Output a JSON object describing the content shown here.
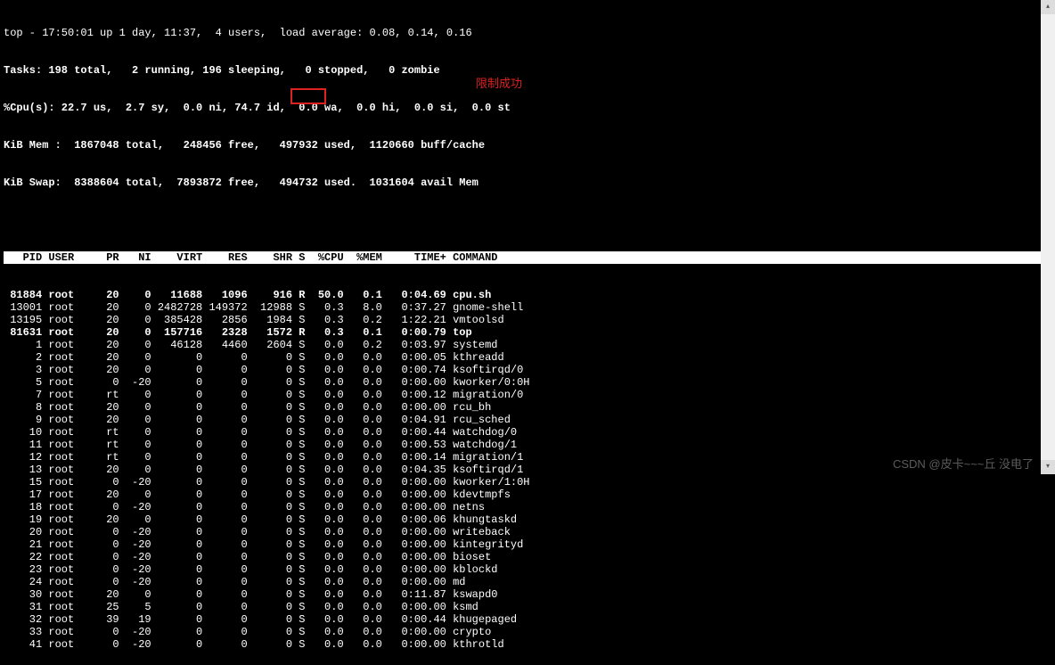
{
  "summary": {
    "line1": "top - 17:50:01 up 1 day, 11:37,  4 users,  load average: 0.08, 0.14, 0.16",
    "line2": "Tasks: 198 total,   2 running, 196 sleeping,   0 stopped,   0 zombie",
    "line3": "%Cpu(s): 22.7 us,  2.7 sy,  0.0 ni, 74.7 id,  0.0 wa,  0.0 hi,  0.0 si,  0.0 st",
    "line4": "KiB Mem :  1867048 total,   248456 free,   497932 used,  1120660 buff/cache",
    "line5": "KiB Swap:  8388604 total,  7893872 free,   494732 used.  1031604 avail Mem"
  },
  "columns": [
    "PID",
    "USER",
    "PR",
    "NI",
    "VIRT",
    "RES",
    "SHR",
    "S",
    "%CPU",
    "%MEM",
    "TIME+",
    "COMMAND"
  ],
  "annotation": "限制成功",
  "processes": [
    {
      "bold": true,
      "pid": "81884",
      "user": "root",
      "pr": "20",
      "ni": "0",
      "virt": "11688",
      "res": "1096",
      "shr": "916",
      "s": "R",
      "cpu": "50.0",
      "mem": "0.1",
      "time": "0:04.69",
      "cmd": "cpu.sh"
    },
    {
      "bold": false,
      "pid": "13001",
      "user": "root",
      "pr": "20",
      "ni": "0",
      "virt": "2482728",
      "res": "149372",
      "shr": "12988",
      "s": "S",
      "cpu": "0.3",
      "mem": "8.0",
      "time": "0:37.27",
      "cmd": "gnome-shell"
    },
    {
      "bold": false,
      "pid": "13195",
      "user": "root",
      "pr": "20",
      "ni": "0",
      "virt": "385428",
      "res": "2856",
      "shr": "1984",
      "s": "S",
      "cpu": "0.3",
      "mem": "0.2",
      "time": "1:22.21",
      "cmd": "vmtoolsd"
    },
    {
      "bold": true,
      "pid": "81631",
      "user": "root",
      "pr": "20",
      "ni": "0",
      "virt": "157716",
      "res": "2328",
      "shr": "1572",
      "s": "R",
      "cpu": "0.3",
      "mem": "0.1",
      "time": "0:00.79",
      "cmd": "top"
    },
    {
      "bold": false,
      "pid": "1",
      "user": "root",
      "pr": "20",
      "ni": "0",
      "virt": "46128",
      "res": "4460",
      "shr": "2604",
      "s": "S",
      "cpu": "0.0",
      "mem": "0.2",
      "time": "0:03.97",
      "cmd": "systemd"
    },
    {
      "bold": false,
      "pid": "2",
      "user": "root",
      "pr": "20",
      "ni": "0",
      "virt": "0",
      "res": "0",
      "shr": "0",
      "s": "S",
      "cpu": "0.0",
      "mem": "0.0",
      "time": "0:00.05",
      "cmd": "kthreadd"
    },
    {
      "bold": false,
      "pid": "3",
      "user": "root",
      "pr": "20",
      "ni": "0",
      "virt": "0",
      "res": "0",
      "shr": "0",
      "s": "S",
      "cpu": "0.0",
      "mem": "0.0",
      "time": "0:00.74",
      "cmd": "ksoftirqd/0"
    },
    {
      "bold": false,
      "pid": "5",
      "user": "root",
      "pr": "0",
      "ni": "-20",
      "virt": "0",
      "res": "0",
      "shr": "0",
      "s": "S",
      "cpu": "0.0",
      "mem": "0.0",
      "time": "0:00.00",
      "cmd": "kworker/0:0H"
    },
    {
      "bold": false,
      "pid": "7",
      "user": "root",
      "pr": "rt",
      "ni": "0",
      "virt": "0",
      "res": "0",
      "shr": "0",
      "s": "S",
      "cpu": "0.0",
      "mem": "0.0",
      "time": "0:00.12",
      "cmd": "migration/0"
    },
    {
      "bold": false,
      "pid": "8",
      "user": "root",
      "pr": "20",
      "ni": "0",
      "virt": "0",
      "res": "0",
      "shr": "0",
      "s": "S",
      "cpu": "0.0",
      "mem": "0.0",
      "time": "0:00.00",
      "cmd": "rcu_bh"
    },
    {
      "bold": false,
      "pid": "9",
      "user": "root",
      "pr": "20",
      "ni": "0",
      "virt": "0",
      "res": "0",
      "shr": "0",
      "s": "S",
      "cpu": "0.0",
      "mem": "0.0",
      "time": "0:04.91",
      "cmd": "rcu_sched"
    },
    {
      "bold": false,
      "pid": "10",
      "user": "root",
      "pr": "rt",
      "ni": "0",
      "virt": "0",
      "res": "0",
      "shr": "0",
      "s": "S",
      "cpu": "0.0",
      "mem": "0.0",
      "time": "0:00.44",
      "cmd": "watchdog/0"
    },
    {
      "bold": false,
      "pid": "11",
      "user": "root",
      "pr": "rt",
      "ni": "0",
      "virt": "0",
      "res": "0",
      "shr": "0",
      "s": "S",
      "cpu": "0.0",
      "mem": "0.0",
      "time": "0:00.53",
      "cmd": "watchdog/1"
    },
    {
      "bold": false,
      "pid": "12",
      "user": "root",
      "pr": "rt",
      "ni": "0",
      "virt": "0",
      "res": "0",
      "shr": "0",
      "s": "S",
      "cpu": "0.0",
      "mem": "0.0",
      "time": "0:00.14",
      "cmd": "migration/1"
    },
    {
      "bold": false,
      "pid": "13",
      "user": "root",
      "pr": "20",
      "ni": "0",
      "virt": "0",
      "res": "0",
      "shr": "0",
      "s": "S",
      "cpu": "0.0",
      "mem": "0.0",
      "time": "0:04.35",
      "cmd": "ksoftirqd/1"
    },
    {
      "bold": false,
      "pid": "15",
      "user": "root",
      "pr": "0",
      "ni": "-20",
      "virt": "0",
      "res": "0",
      "shr": "0",
      "s": "S",
      "cpu": "0.0",
      "mem": "0.0",
      "time": "0:00.00",
      "cmd": "kworker/1:0H"
    },
    {
      "bold": false,
      "pid": "17",
      "user": "root",
      "pr": "20",
      "ni": "0",
      "virt": "0",
      "res": "0",
      "shr": "0",
      "s": "S",
      "cpu": "0.0",
      "mem": "0.0",
      "time": "0:00.00",
      "cmd": "kdevtmpfs"
    },
    {
      "bold": false,
      "pid": "18",
      "user": "root",
      "pr": "0",
      "ni": "-20",
      "virt": "0",
      "res": "0",
      "shr": "0",
      "s": "S",
      "cpu": "0.0",
      "mem": "0.0",
      "time": "0:00.00",
      "cmd": "netns"
    },
    {
      "bold": false,
      "pid": "19",
      "user": "root",
      "pr": "20",
      "ni": "0",
      "virt": "0",
      "res": "0",
      "shr": "0",
      "s": "S",
      "cpu": "0.0",
      "mem": "0.0",
      "time": "0:00.06",
      "cmd": "khungtaskd"
    },
    {
      "bold": false,
      "pid": "20",
      "user": "root",
      "pr": "0",
      "ni": "-20",
      "virt": "0",
      "res": "0",
      "shr": "0",
      "s": "S",
      "cpu": "0.0",
      "mem": "0.0",
      "time": "0:00.00",
      "cmd": "writeback"
    },
    {
      "bold": false,
      "pid": "21",
      "user": "root",
      "pr": "0",
      "ni": "-20",
      "virt": "0",
      "res": "0",
      "shr": "0",
      "s": "S",
      "cpu": "0.0",
      "mem": "0.0",
      "time": "0:00.00",
      "cmd": "kintegrityd"
    },
    {
      "bold": false,
      "pid": "22",
      "user": "root",
      "pr": "0",
      "ni": "-20",
      "virt": "0",
      "res": "0",
      "shr": "0",
      "s": "S",
      "cpu": "0.0",
      "mem": "0.0",
      "time": "0:00.00",
      "cmd": "bioset"
    },
    {
      "bold": false,
      "pid": "23",
      "user": "root",
      "pr": "0",
      "ni": "-20",
      "virt": "0",
      "res": "0",
      "shr": "0",
      "s": "S",
      "cpu": "0.0",
      "mem": "0.0",
      "time": "0:00.00",
      "cmd": "kblockd"
    },
    {
      "bold": false,
      "pid": "24",
      "user": "root",
      "pr": "0",
      "ni": "-20",
      "virt": "0",
      "res": "0",
      "shr": "0",
      "s": "S",
      "cpu": "0.0",
      "mem": "0.0",
      "time": "0:00.00",
      "cmd": "md"
    },
    {
      "bold": false,
      "pid": "30",
      "user": "root",
      "pr": "20",
      "ni": "0",
      "virt": "0",
      "res": "0",
      "shr": "0",
      "s": "S",
      "cpu": "0.0",
      "mem": "0.0",
      "time": "0:11.87",
      "cmd": "kswapd0"
    },
    {
      "bold": false,
      "pid": "31",
      "user": "root",
      "pr": "25",
      "ni": "5",
      "virt": "0",
      "res": "0",
      "shr": "0",
      "s": "S",
      "cpu": "0.0",
      "mem": "0.0",
      "time": "0:00.00",
      "cmd": "ksmd"
    },
    {
      "bold": false,
      "pid": "32",
      "user": "root",
      "pr": "39",
      "ni": "19",
      "virt": "0",
      "res": "0",
      "shr": "0",
      "s": "S",
      "cpu": "0.0",
      "mem": "0.0",
      "time": "0:00.44",
      "cmd": "khugepaged"
    },
    {
      "bold": false,
      "pid": "33",
      "user": "root",
      "pr": "0",
      "ni": "-20",
      "virt": "0",
      "res": "0",
      "shr": "0",
      "s": "S",
      "cpu": "0.0",
      "mem": "0.0",
      "time": "0:00.00",
      "cmd": "crypto"
    },
    {
      "bold": false,
      "pid": "41",
      "user": "root",
      "pr": "0",
      "ni": "-20",
      "virt": "0",
      "res": "0",
      "shr": "0",
      "s": "S",
      "cpu": "0.0",
      "mem": "0.0",
      "time": "0:00.00",
      "cmd": "kthrotld"
    }
  ],
  "watermark": "CSDN @皮卡~~~丘 没电了"
}
